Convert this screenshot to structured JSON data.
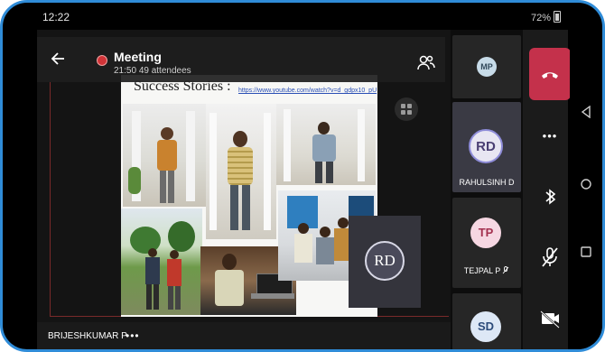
{
  "status_bar": {
    "time": "12:22",
    "battery": "72%"
  },
  "meeting": {
    "title": "Meeting",
    "duration": "21:50",
    "attendees": "49 attendees"
  },
  "slide": {
    "title": "Success Stories :",
    "link": "https://www.youtube.com/watch?v=d_gdpx10_pU"
  },
  "presenter_tile": {
    "logo_initials": "RD"
  },
  "self_view": {
    "name": "BRIJESHKUMAR P",
    "more": "•••"
  },
  "participants": [
    {
      "initials": "MP",
      "name": "",
      "muted": false
    },
    {
      "initials": "RD",
      "name": "RAHULSINH D",
      "muted": false
    },
    {
      "initials": "TP",
      "name": "TEJPAL P",
      "muted": true
    },
    {
      "initials": "SD",
      "name": "",
      "muted": false
    }
  ],
  "controls": {
    "more": "•••"
  },
  "icons": [
    "back-arrow-icon",
    "people-icon",
    "grid-icon",
    "hangup-icon",
    "bluetooth-icon",
    "mic-off-icon",
    "camera-off-icon",
    "nav-back-icon",
    "nav-home-icon",
    "nav-recents-icon"
  ],
  "colors": {
    "hangup": "#c4314b",
    "record": "#d13438",
    "frame": "#2f8cd8"
  }
}
